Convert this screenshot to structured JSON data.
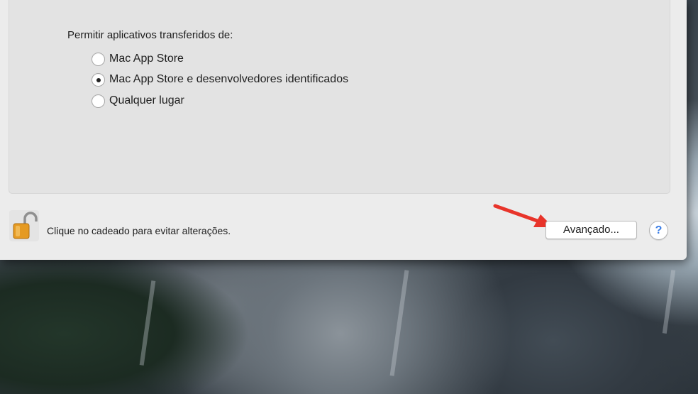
{
  "settings": {
    "prompt": "Permitir aplicativos transferidos de:",
    "options": [
      {
        "label": "Mac App Store",
        "checked": false
      },
      {
        "label": "Mac App Store e desenvolvedores identificados",
        "checked": true
      },
      {
        "label": "Qualquer lugar",
        "checked": false
      }
    ]
  },
  "footer": {
    "lock_icon": "open-padlock-icon",
    "lock_text": "Clique no cadeado para evitar alterações.",
    "advanced_label": "Avançado...",
    "help_label": "?"
  },
  "annotation": {
    "arrow_color": "#e8342a"
  }
}
